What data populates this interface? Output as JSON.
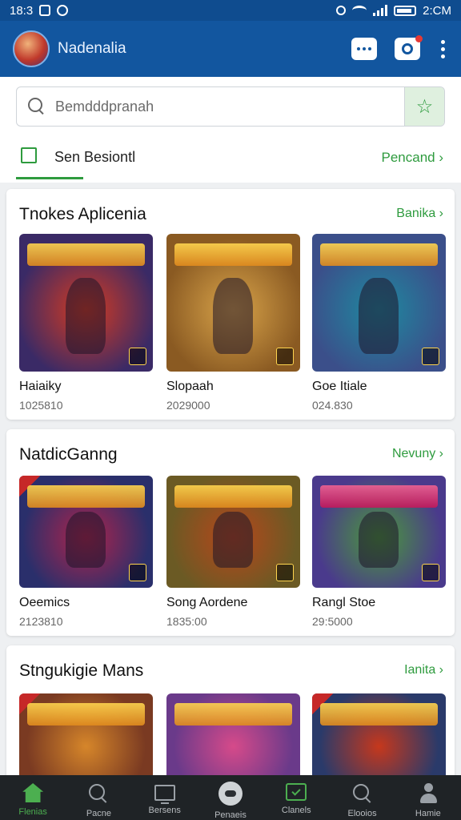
{
  "status_bar": {
    "time": "18:3",
    "right_text": "2:CM"
  },
  "app_bar": {
    "title": "Nadenalia"
  },
  "search": {
    "placeholder": "Bemdddpranah"
  },
  "filter": {
    "label": "Sen Besiontl",
    "link": "Pencand ›"
  },
  "sections": [
    {
      "title": "Tnokes Aplicenia",
      "link": "Banika ›",
      "items": [
        {
          "name": "Haiaiky",
          "count": "1025810",
          "bg": "#3a2a66",
          "accent": "#d63a1f"
        },
        {
          "name": "Slopaah",
          "count": "2029000",
          "bg": "#8a5a22",
          "accent": "#2c2f3a"
        },
        {
          "name": "Goe Itiale",
          "count": "024.830",
          "bg": "#3b4f8a",
          "accent": "#1e8aa0"
        }
      ]
    },
    {
      "title": "NatdicGanng",
      "link": "Nevuny ›",
      "items": [
        {
          "name": "Oeemics",
          "count": "2123810",
          "bg": "#2a2f6b",
          "accent": "#b0234a"
        },
        {
          "name": "Song Aordene",
          "count": "1835:00",
          "bg": "#6b5a24",
          "accent": "#b7461b"
        },
        {
          "name": "Rangl Stoe",
          "count": "29:5000",
          "bg": "#4a3a8c",
          "accent": "#4a9a3a"
        }
      ]
    },
    {
      "title": "Stngukigie Mans",
      "link": "Ianita ›",
      "items": [
        {
          "name": "",
          "count": "",
          "bg": "#7a3a22",
          "accent": "#d6862a"
        },
        {
          "name": "",
          "count": "",
          "bg": "#6a3a8a",
          "accent": "#d64a8a"
        },
        {
          "name": "",
          "count": "",
          "bg": "#2a3a6a",
          "accent": "#c6381c"
        }
      ]
    }
  ],
  "bottom_nav": [
    {
      "label": "Flenias",
      "icon": "home-icon",
      "active": true
    },
    {
      "label": "Pacne",
      "icon": "search-icon",
      "active": false
    },
    {
      "label": "Bersens",
      "icon": "tv-icon",
      "active": false
    },
    {
      "label": "Penaeis",
      "icon": "gamepad-icon",
      "active": false
    },
    {
      "label": "Clanels",
      "icon": "screen-icon",
      "active": false
    },
    {
      "label": "Elooios",
      "icon": "search-icon",
      "active": false
    },
    {
      "label": "Hamie",
      "icon": "person-icon",
      "active": false
    }
  ]
}
